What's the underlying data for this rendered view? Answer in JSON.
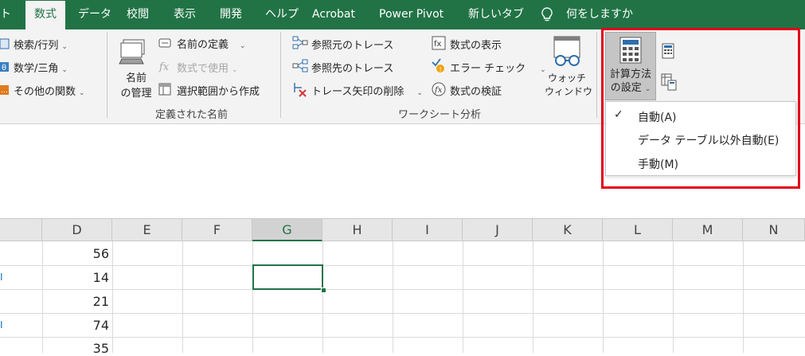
{
  "tabs": [
    "ト",
    "数式",
    "データ",
    "校閲",
    "表示",
    "開発",
    "ヘルプ",
    "Acrobat",
    "Power Pivot",
    "新しいタブ",
    "何をしますか"
  ],
  "ribbon": {
    "lookup": "検索/行列",
    "math": "数学/三角",
    "other_funcs": "その他の関数",
    "name_manager_1": "名前",
    "name_manager_2": "の管理",
    "define_name": "名前の定義",
    "use_in_formula": "数式で使用",
    "create_from_selection": "選択範囲から作成",
    "group_defined_names": "定義された名前",
    "trace_precedents": "参照元のトレース",
    "trace_dependents": "参照先のトレース",
    "remove_arrows": "トレース矢印の削除",
    "show_formulas": "数式の表示",
    "error_checking": "エラー チェック",
    "evaluate_formula": "数式の検証",
    "watch_window_1": "ウォッチ",
    "watch_window_2": "ウィンドウ",
    "group_formula_auditing": "ワークシート分析",
    "calc_options_1": "計算方法",
    "calc_options_2": "の設定"
  },
  "dropdown": {
    "check": "✓",
    "items": [
      "自動(A)",
      "データ テーブル以外自動(E)",
      "手動(M)"
    ]
  },
  "columns": [
    "D",
    "E",
    "F",
    "G",
    "H",
    "I",
    "J",
    "K",
    "L",
    "M",
    "N"
  ],
  "cells": [
    "56",
    "14",
    "21",
    "74",
    "35"
  ],
  "row_marks": [
    "I",
    "I"
  ],
  "colors": {
    "excel_green": "#217346",
    "highlight_red": "#e2001a"
  }
}
